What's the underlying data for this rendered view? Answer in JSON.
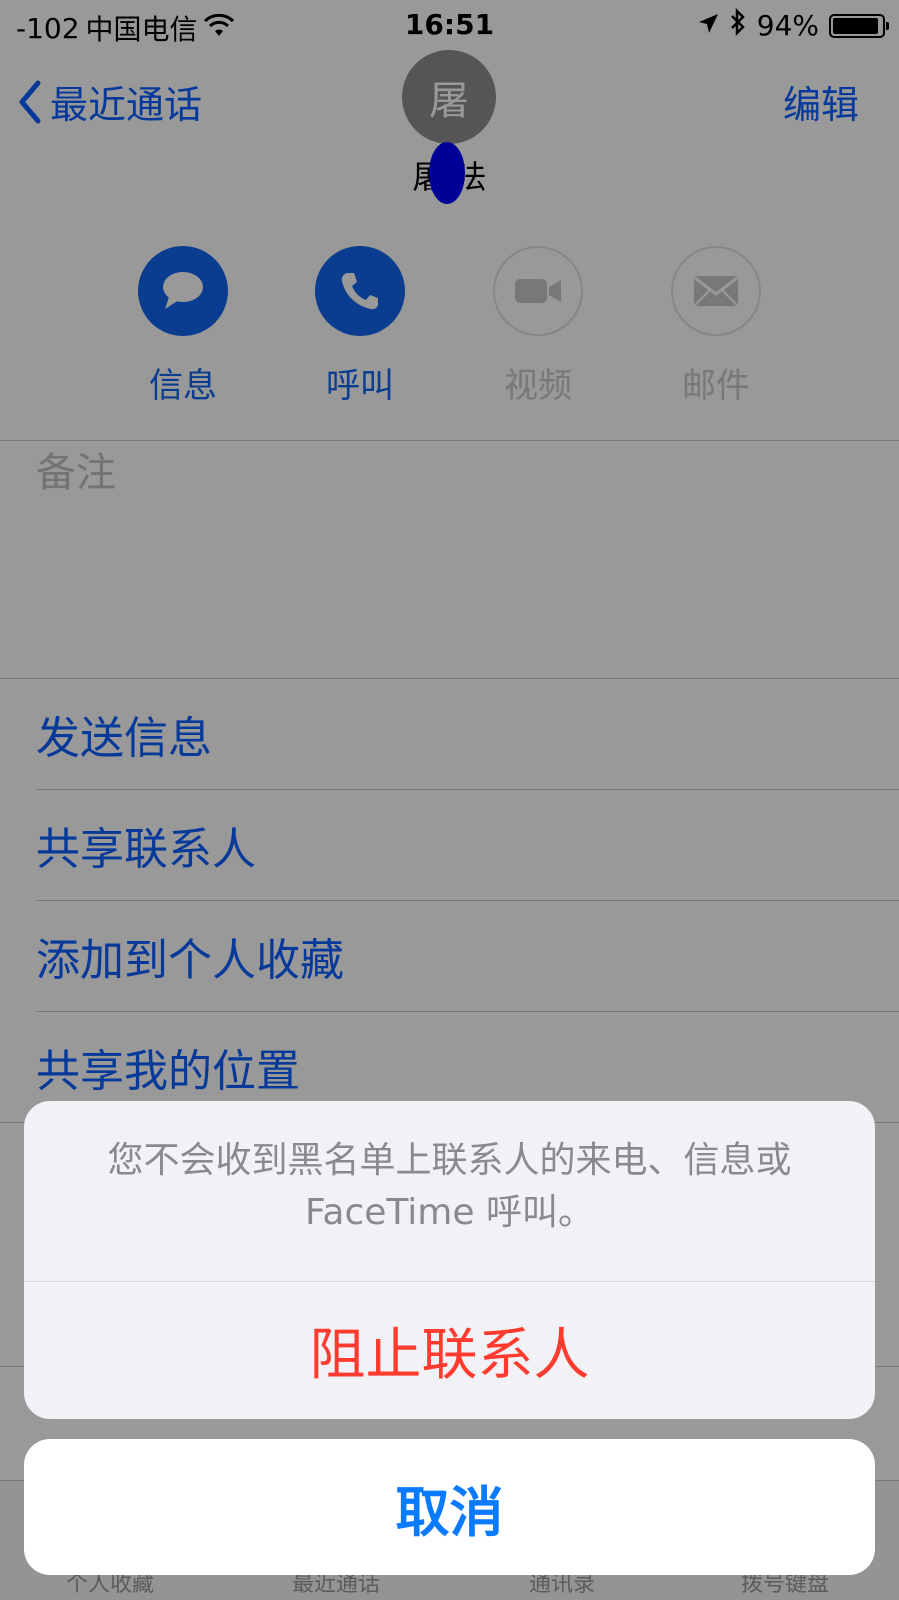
{
  "status_bar": {
    "signal": "-102",
    "carrier": "中国电信",
    "time": "16:51",
    "battery_text": "94%",
    "battery_level": 0.94,
    "icons": [
      "wifi-icon",
      "location-arrow-icon",
      "bluetooth-icon",
      "battery-icon"
    ]
  },
  "nav": {
    "back_label": "最近通话",
    "edit_label": "编辑"
  },
  "contact": {
    "avatar_initial": "屠",
    "name": "屠 法"
  },
  "actions": [
    {
      "label": "信息",
      "icon": "message-bubble-icon",
      "enabled": true
    },
    {
      "label": "呼叫",
      "icon": "phone-icon",
      "enabled": true
    },
    {
      "label": "视频",
      "icon": "video-camera-icon",
      "enabled": false
    },
    {
      "label": "邮件",
      "icon": "envelope-icon",
      "enabled": false
    }
  ],
  "notes_title": "备注",
  "rows": [
    "发送信息",
    "共享联系人",
    "添加到个人收藏",
    "共享我的位置"
  ],
  "tabbar": [
    "个人收藏",
    "最近通话",
    "通讯录",
    "拨号键盘"
  ],
  "sheet": {
    "message": "您不会收到黑名单上联系人的来电、信息或 FaceTime 呼叫。",
    "destructive_label": "阻止联系人",
    "cancel_label": "取消"
  },
  "colors": {
    "accent": "#1167ef",
    "destructive": "#ff3b30",
    "cancel": "#0a7aff",
    "redaction": "#0000ff"
  }
}
